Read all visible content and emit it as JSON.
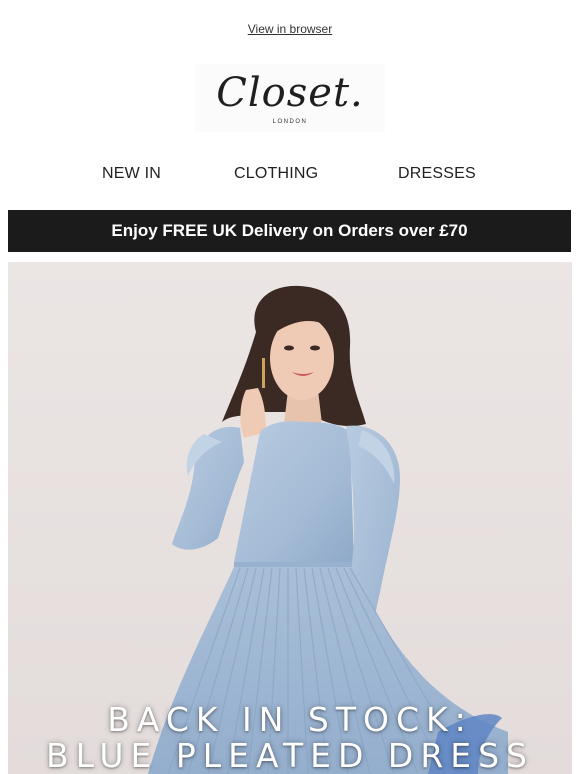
{
  "header": {
    "view_in_browser": "View in browser",
    "logo_text": "Closet.",
    "logo_subtext": "LONDON"
  },
  "nav": {
    "items": [
      {
        "label": "NEW IN"
      },
      {
        "label": "CLOTHING"
      },
      {
        "label": "DRESSES"
      }
    ]
  },
  "promo_banner": {
    "text": "Enjoy FREE UK Delivery on Orders over £70",
    "background": "#1b1b1b"
  },
  "hero": {
    "line1": "BACK IN STOCK:",
    "line2": "BLUE PLEATED DRESS",
    "background": "#e8e2e1",
    "dress_color": "#a9bfd8"
  }
}
